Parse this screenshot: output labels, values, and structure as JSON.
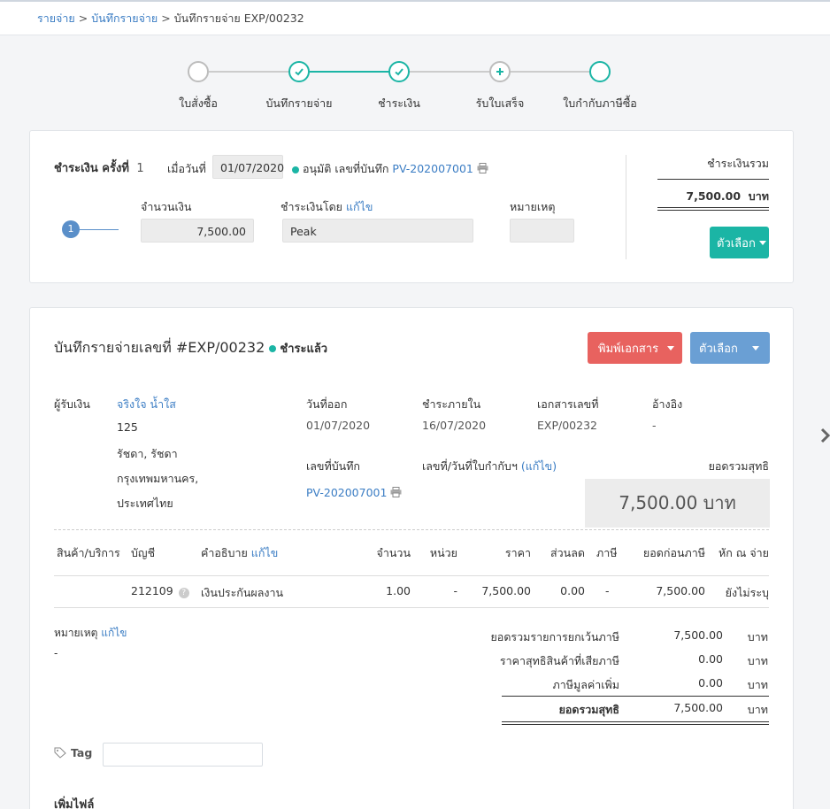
{
  "breadcrumb": {
    "item1": "รายจ่าย",
    "item2": "บันทึกรายจ่าย",
    "current": "บันทึกรายจ่าย EXP/00232",
    "sep": ">"
  },
  "stepper": {
    "steps": [
      {
        "label": "ใบสั่งซื้อ",
        "state": "empty"
      },
      {
        "label": "บันทึกรายจ่าย",
        "state": "done"
      },
      {
        "label": "ชำระเงิน",
        "state": "done"
      },
      {
        "label": "รับใบเสร็จ",
        "state": "add"
      },
      {
        "label": "ใบกำกับภาษีซื้อ",
        "state": "pending"
      }
    ]
  },
  "payment": {
    "title": "ชำระเงิน ครั้งที่",
    "number": "1",
    "date_label": "เมื่อวันที่",
    "date": "01/07/2020",
    "status": "อนุมัติ",
    "record_label": "เลขที่บันทึก",
    "record_no": "PV-202007001",
    "amount_label": "จำนวนเงิน",
    "amount": "7,500.00",
    "paid_by_label": "ชำระเงินโดย",
    "edit": "แก้ไข",
    "paid_by": "Peak",
    "note_label": "หมายเหตุ",
    "note": "",
    "row_index": "1",
    "total_label": "ชำระเงินรวม",
    "total": "7,500.00",
    "total_unit": "บาท",
    "options_button": "ตัวเลือก"
  },
  "expense": {
    "title": "บันทึกรายจ่ายเลขที่ #EXP/00232",
    "status": "ชำระแล้ว",
    "print_button": "พิมพ์เอกสาร",
    "options_button": "ตัวเลือก",
    "payee_label": "ผู้รับเงิน",
    "payee_name": "จริงใจ น้ำใส",
    "address": [
      "125",
      "รัชดา, รัชดา",
      "กรุงเทพมหานคร,",
      "ประเทศไทย"
    ],
    "issue_date_label": "วันที่ออก",
    "issue_date": "01/07/2020",
    "due_label": "ชำระภายใน",
    "due_date": "16/07/2020",
    "doc_no_label": "เอกสารเลขที่",
    "doc_no": "EXP/00232",
    "ref_label": "อ้างอิง",
    "ref": "-",
    "record_label": "เลขที่บันทึก",
    "record_no": "PV-202007001",
    "tax_inv_label": "เลขที่/วันที่ใบกำกับฯ",
    "tax_inv_edit": "(แก้ไข)",
    "net_label": "ยอดรวมสุทธิ",
    "net_total": "7,500.00 บาท",
    "columns": {
      "product": "สินค้า/บริการ",
      "account": "บัญชี",
      "desc": "คำอธิบาย",
      "desc_edit": "แก้ไข",
      "qty": "จำนวน",
      "unit": "หน่วย",
      "price": "ราคา",
      "discount": "ส่วนลด",
      "tax": "ภาษี",
      "pre_tax": "ยอดก่อนภาษี",
      "wht": "หัก ณ จ่าย"
    },
    "row": {
      "account": "212109",
      "desc": "เงินประกันผลงาน",
      "qty": "1.00",
      "unit": "-",
      "price": "7,500.00",
      "discount": "0.00",
      "tax": "-",
      "pre_tax": "7,500.00",
      "wht": "ยังไม่ระบุ"
    },
    "note_label": "หมายเหตุ",
    "note_edit": "แก้ไข",
    "note": "-",
    "summary": [
      {
        "label": "ยอดรวมรายการยกเว้นภาษี",
        "value": "7,500.00",
        "unit": "บาท"
      },
      {
        "label": "ราคาสุทธิสินค้าที่เสียภาษี",
        "value": "0.00",
        "unit": "บาท"
      },
      {
        "label": "ภาษีมูลค่าเพิ่ม",
        "value": "0.00",
        "unit": "บาท"
      },
      {
        "label": "ยอดรวมสุทธิ",
        "value": "7,500.00",
        "unit": "บาท"
      }
    ],
    "tag_label": "Tag",
    "tag_value": "",
    "add_file": "เพิ่มไฟล์"
  },
  "colors": {
    "teal": "#1bb5a5",
    "red": "#e8625f",
    "blue": "#6a9fd4",
    "link": "#3b7dc4"
  }
}
